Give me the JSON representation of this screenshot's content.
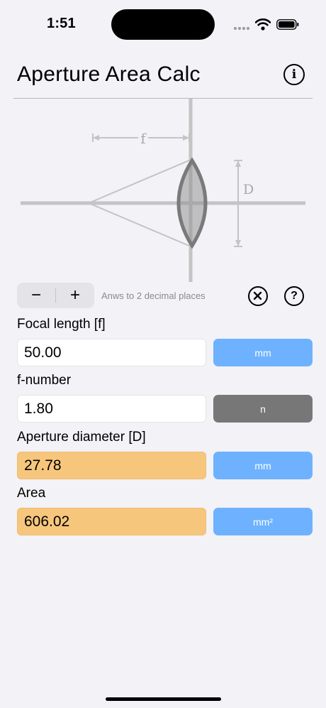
{
  "status": {
    "time": "1:51"
  },
  "header": {
    "title": "Aperture Area Calc",
    "info_icon": "info-circle-icon"
  },
  "diagram": {
    "focal_label": "f",
    "diameter_label": "D"
  },
  "toolbar": {
    "minus_label": "−",
    "plus_label": "+",
    "decimals_note": "Anws to 2 decimal places",
    "clear_icon": "clear-circle-icon",
    "help_label": "?"
  },
  "fields": [
    {
      "label": "Focal length [f]",
      "value": "50.00",
      "unit": "mm",
      "is_result": false,
      "unit_selected": false
    },
    {
      "label": "f-number",
      "value": "1.80",
      "unit": "n",
      "is_result": false,
      "unit_selected": true
    },
    {
      "label": "Aperture diameter [D]",
      "value": "27.78",
      "unit": "mm",
      "is_result": true,
      "unit_selected": false
    },
    {
      "label": "Area",
      "value": "606.02",
      "unit": "mm²",
      "is_result": true,
      "unit_selected": false
    }
  ],
  "colors": {
    "result_fill": "#f7c67d",
    "unit_button": "#6eb2ff",
    "unit_button_selected": "#777777",
    "background": "#f2f2f7"
  }
}
